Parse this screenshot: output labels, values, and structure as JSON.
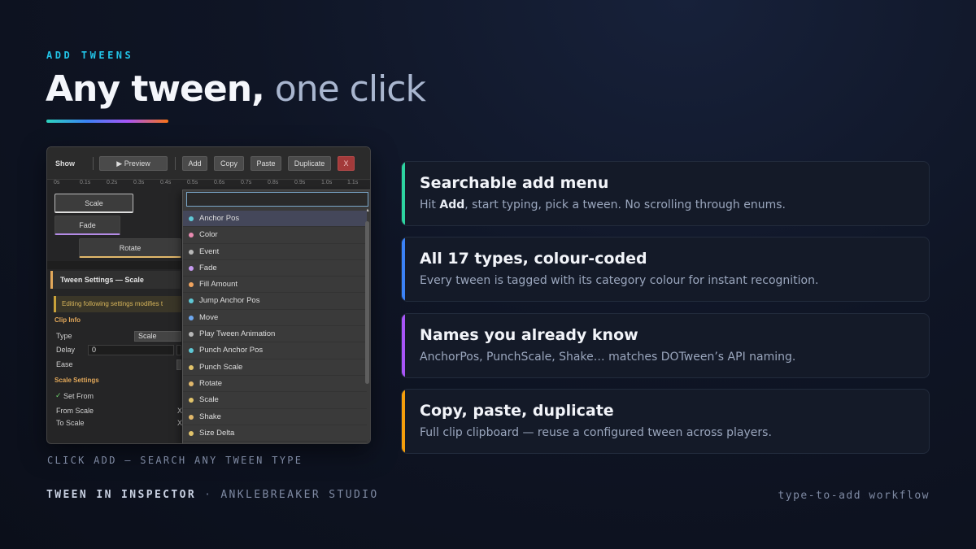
{
  "slide": {
    "eyebrow": "ADD TWEENS",
    "headline_strong": "Any tween,",
    "headline_light": "one click",
    "caption": "CLICK ADD — SEARCH ANY TWEEN TYPE",
    "footer_brand": "TWEEN IN INSPECTOR",
    "footer_sep": "·",
    "footer_studio": "ANKLEBREAKER STUDIO",
    "footer_right": "type-to-add workflow"
  },
  "editor": {
    "toolbar": {
      "show_label": "Show",
      "preview_label": "▶ Preview",
      "add_label": "Add",
      "copy_label": "Copy",
      "paste_label": "Paste",
      "duplicate_label": "Duplicate",
      "close_label": "X"
    },
    "ruler": [
      "0s",
      "0.1s",
      "0.2s",
      "0.3s",
      "0.4s",
      "0.5s",
      "0.6s",
      "0.7s",
      "0.8s",
      "0.9s",
      "1.0s",
      "1.1s"
    ],
    "clips": {
      "scale": "Scale",
      "fade": "Fade",
      "rotate": "Rotate"
    },
    "settings": {
      "header": "Tween Settings — Scale",
      "warning": "Editing following settings modifies t",
      "clip_info_label": "Clip Info",
      "type_label": "Type",
      "type_value": "Scale",
      "delay_label": "Delay",
      "delay_value": "0",
      "ease_label": "Ease",
      "scale_settings_label": "Scale Settings",
      "set_from_check": "✓",
      "set_from_label": "Set From",
      "from_scale_label": "From Scale",
      "to_scale_label": "To Scale",
      "axis_char": "X"
    },
    "menu": {
      "search_value": "",
      "scroll_up": "▲",
      "items": [
        {
          "label": "Anchor Pos",
          "color": "#5fc8d6"
        },
        {
          "label": "Color",
          "color": "#e88ab0"
        },
        {
          "label": "Event",
          "color": "#b8b8b8"
        },
        {
          "label": "Fade",
          "color": "#c69af0"
        },
        {
          "label": "Fill Amount",
          "color": "#f0a35e"
        },
        {
          "label": "Jump Anchor Pos",
          "color": "#5fc8d6"
        },
        {
          "label": "Move",
          "color": "#6ea8f0"
        },
        {
          "label": "Play Tween Animation",
          "color": "#b8b8b8"
        },
        {
          "label": "Punch Anchor Pos",
          "color": "#5fc8d6"
        },
        {
          "label": "Punch Scale",
          "color": "#e2c46b"
        },
        {
          "label": "Rotate",
          "color": "#e2b86b"
        },
        {
          "label": "Scale",
          "color": "#e2c46b"
        },
        {
          "label": "Shake",
          "color": "#e2b86b"
        },
        {
          "label": "Size Delta",
          "color": "#e2c46b"
        }
      ]
    }
  },
  "cards": [
    {
      "title": "Searchable add menu",
      "desc_pre": "Hit ",
      "desc_bold": "Add",
      "desc_post": ", start typing, pick a tween. No scrolling through enums.",
      "accent": "#2dd4a0"
    },
    {
      "title": "All 17 types, colour-coded",
      "desc_pre": "Every tween is tagged with its category colour for instant recognition.",
      "desc_bold": "",
      "desc_post": "",
      "accent": "#3b82f6"
    },
    {
      "title": "Names you already know",
      "desc_pre": "AnchorPos, PunchScale, Shake… matches DOTween’s API naming.",
      "desc_bold": "",
      "desc_post": "",
      "accent": "#a855f7"
    },
    {
      "title": "Copy, paste, duplicate",
      "desc_pre": "Full clip clipboard — reuse a configured tween across players.",
      "desc_bold": "",
      "desc_post": "",
      "accent": "#f59e0b"
    }
  ]
}
